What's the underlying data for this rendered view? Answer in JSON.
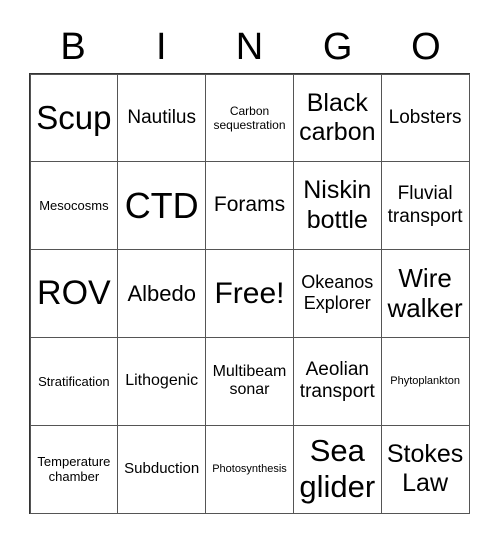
{
  "header": [
    "B",
    "I",
    "N",
    "G",
    "O"
  ],
  "cells": [
    "Scup",
    "Nautilus",
    "Carbon sequestration",
    "Black carbon",
    "Lobsters",
    "Mesocosms",
    "CTD",
    "Forams",
    "Niskin bottle",
    "Fluvial transport",
    "ROV",
    "Albedo",
    "Free!",
    "Okeanos Explorer",
    "Wire walker",
    "Stratification",
    "Lithogenic",
    "Multibeam sonar",
    "Aeolian transport",
    "Phytoplankton",
    "Temperature chamber",
    "Subduction",
    "Photosynthesis",
    "Sea glider",
    "Stokes Law"
  ]
}
